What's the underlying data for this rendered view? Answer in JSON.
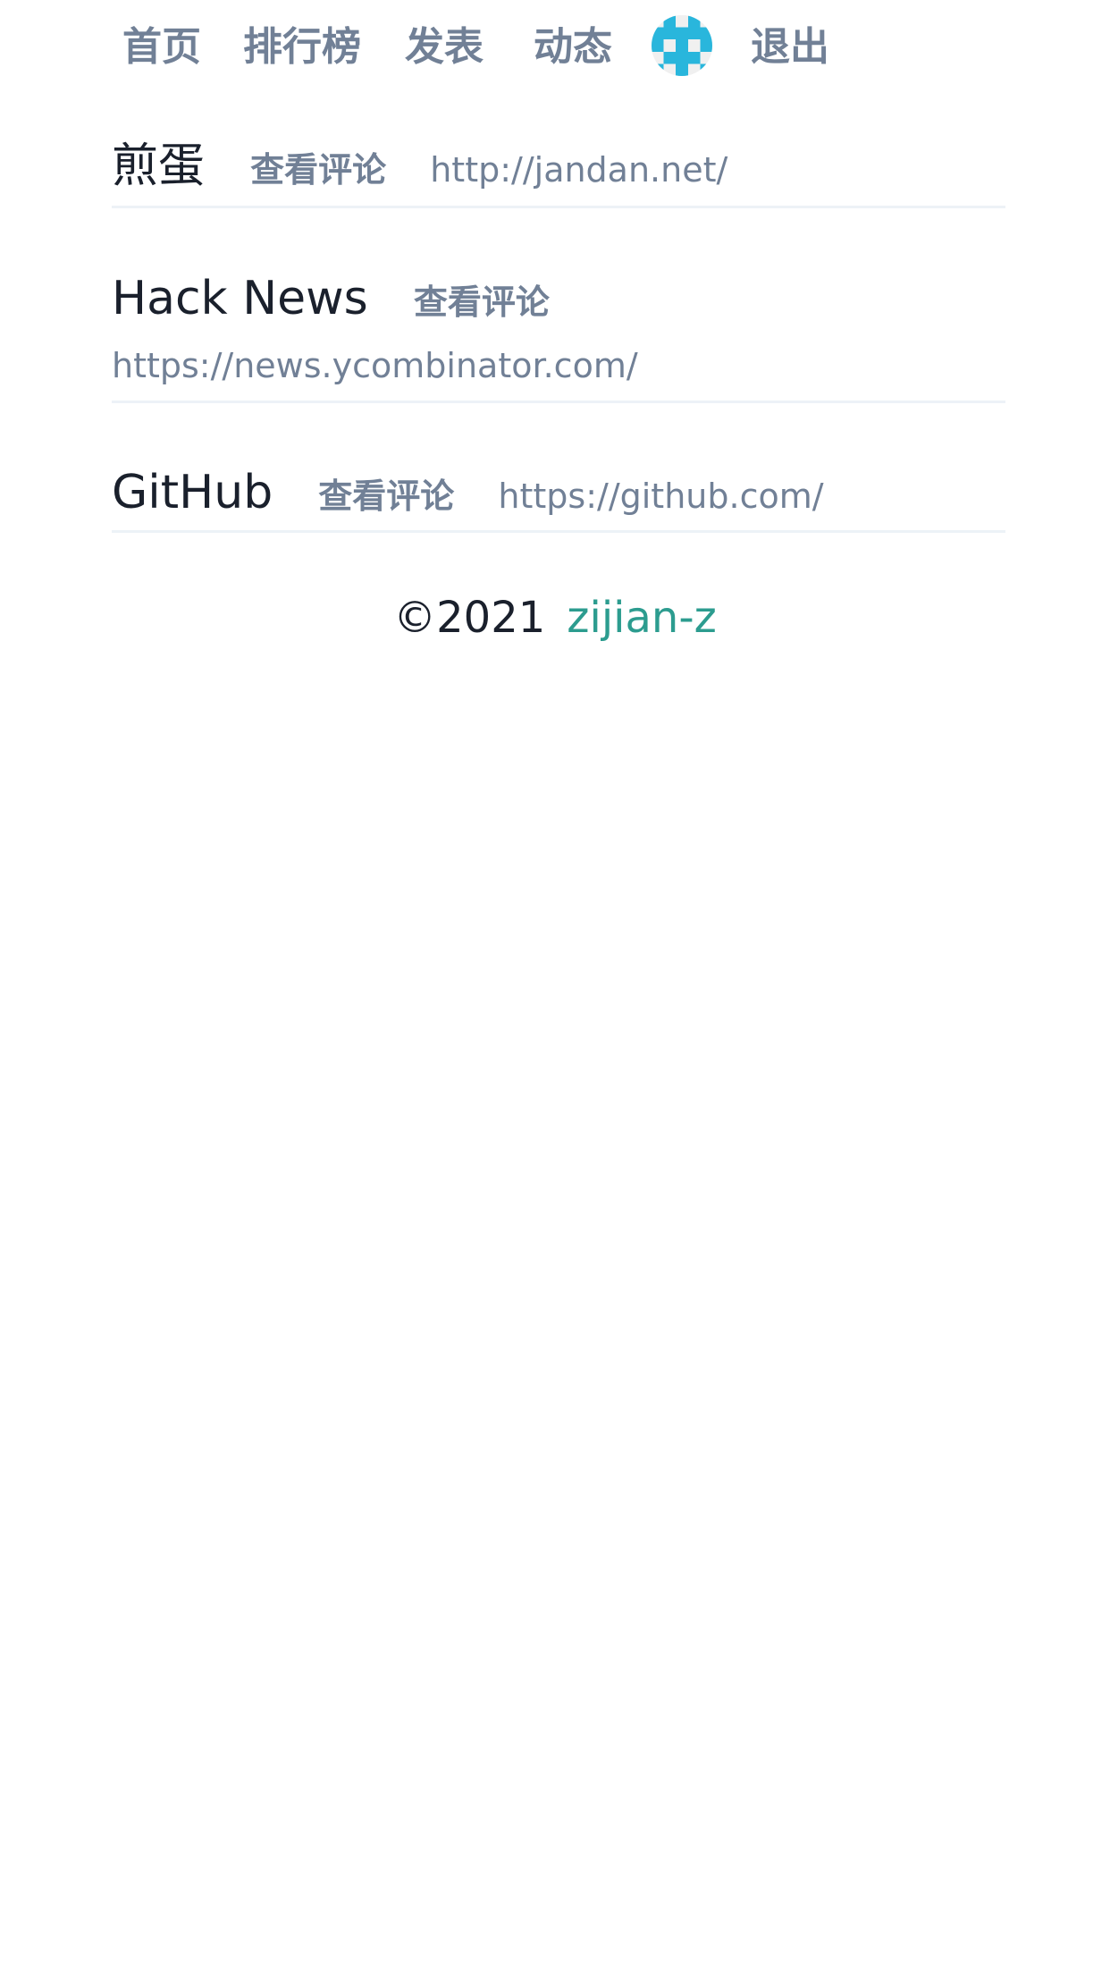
{
  "nav": {
    "home": "首页",
    "ranking": "排行榜",
    "post": "发表",
    "activity": "动态",
    "logout": "退出"
  },
  "sites": [
    {
      "title": "煎蛋",
      "comments": "查看评论",
      "url": "http://jandan.net/"
    },
    {
      "title": "Hack News",
      "comments": "查看评论",
      "url": "https://news.ycombinator.com/"
    },
    {
      "title": "GitHub",
      "comments": "查看评论",
      "url": "https://github.com/"
    }
  ],
  "footer": {
    "copyright": "©2021",
    "author": "zijian-z"
  },
  "colors": {
    "nav_text": "#718096",
    "title_text": "#1a202c",
    "accent": "#2c9c8f",
    "avatar": "#29b6dc",
    "divider": "#edf2f7"
  },
  "icons": {
    "avatar": "identicon-avatar"
  }
}
